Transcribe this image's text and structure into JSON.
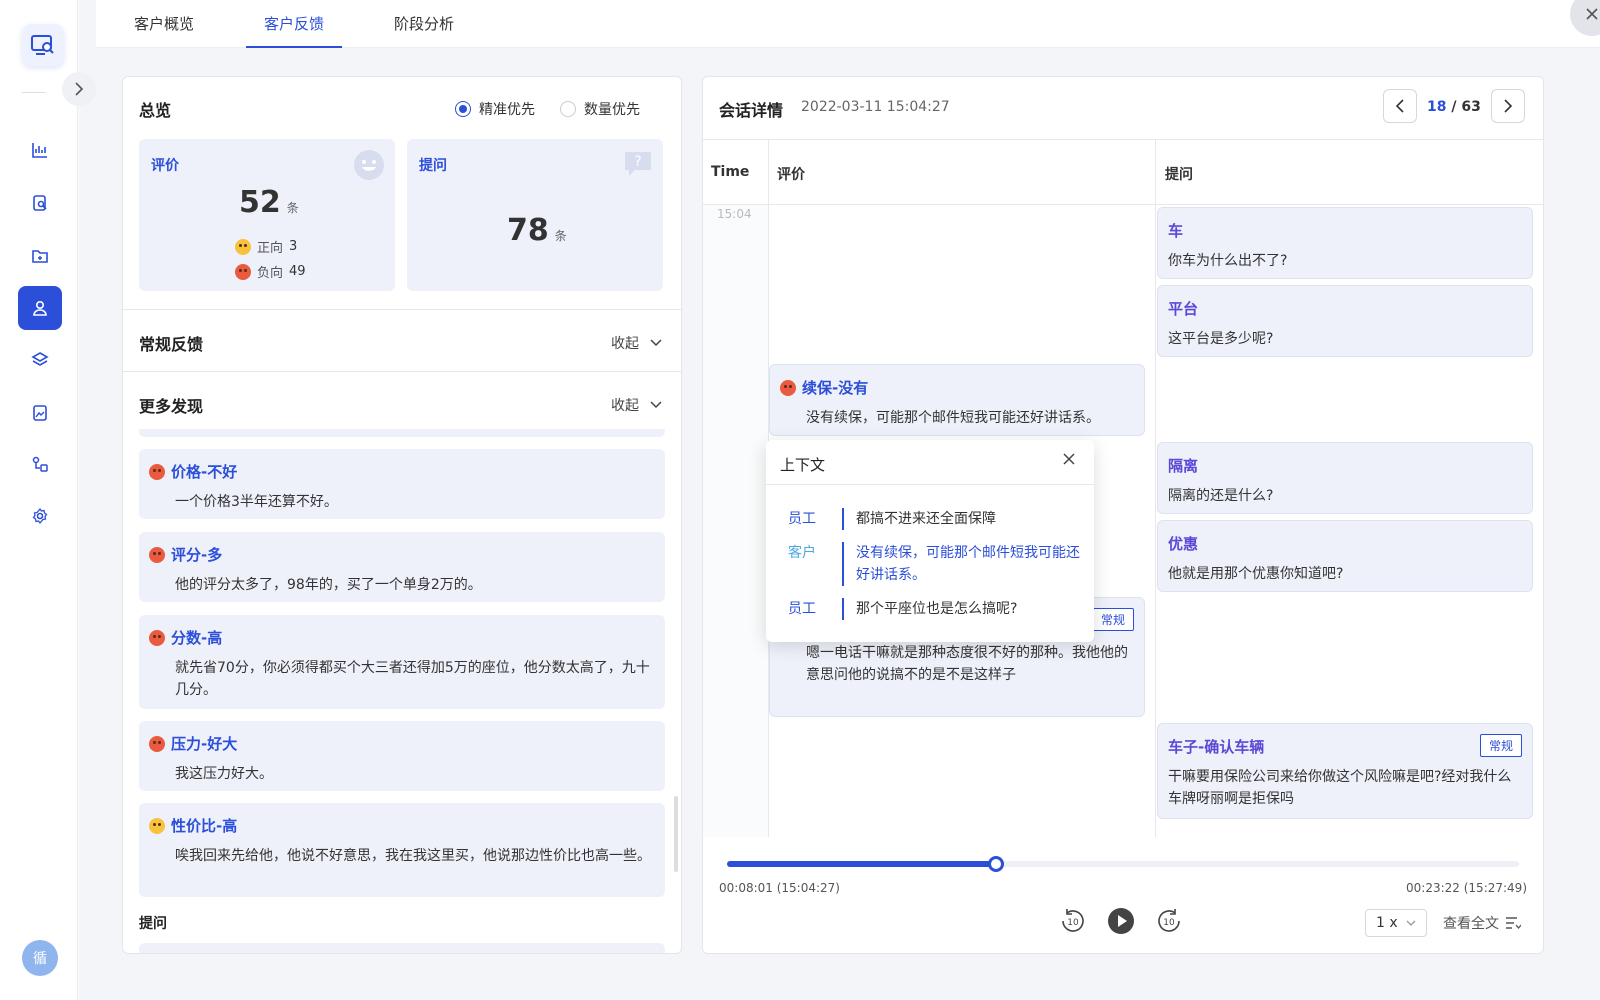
{
  "sidebar": {
    "avatar_text": "循",
    "icons": [
      "chart-icon",
      "search-document-icon",
      "folder-icon",
      "user-icon",
      "layers-icon",
      "image-icon",
      "share-icon",
      "settings-icon"
    ]
  },
  "tabs": [
    {
      "label": "客户概览"
    },
    {
      "label": "客户反馈",
      "active": true
    },
    {
      "label": "阶段分析"
    }
  ],
  "overview": {
    "title": "总览",
    "radio_precise": "精准优先",
    "radio_quantity": "数量优先",
    "review": {
      "label": "评价",
      "count": "52",
      "unit": "条",
      "positive_label": "正向",
      "positive_count": "3",
      "negative_label": "负向",
      "negative_count": "49"
    },
    "question": {
      "label": "提问",
      "count": "78",
      "unit": "条"
    }
  },
  "sections": {
    "regular": {
      "title": "常规反馈",
      "collapse": "收起"
    },
    "more": {
      "title": "更多发现",
      "collapse": "收起"
    },
    "question_footer": "提问"
  },
  "feedback_items": [
    {
      "title": "价格-不好",
      "body": "一个价格3半年还算不好。",
      "sentiment": "negative"
    },
    {
      "title": "评分-多",
      "body": "他的评分太多了，98年的，买了一个单身2万的。",
      "sentiment": "negative"
    },
    {
      "title": "分数-高",
      "body": "就先省70分，你必须得都买个大三者还得加5万的座位，他分数太高了，九十几分。",
      "sentiment": "negative"
    },
    {
      "title": "压力-好大",
      "body": "我这压力好大。",
      "sentiment": "negative"
    },
    {
      "title": "性价比-高",
      "body": "唉我回来先给他，他说不好意思，我在我这里买，他说那边性价比也高一些。",
      "sentiment": "positive"
    }
  ],
  "session": {
    "title": "会话详情",
    "datetime": "2022-03-11 15:04:27",
    "page_current": "18",
    "page_total": "/ 63",
    "col_time": "Time",
    "col_review": "评价",
    "col_question": "提问",
    "time_mark": "15:04"
  },
  "review_bubbles": [
    {
      "title": "续保-没有",
      "body": "没有续保，可能那个邮件短我可能还好讲话系。"
    },
    {
      "title": "",
      "tag": "常规",
      "body": "嗯一电话干嘛就是那种态度很不好的那种。我他他的意思问他的说搞不的是不是这样子"
    }
  ],
  "question_bubbles": [
    {
      "title": "车",
      "body": "你车为什么出不了?"
    },
    {
      "title": "平台",
      "body": "这平台是多少呢?"
    },
    {
      "title": "隔离",
      "body": "隔离的还是什么?"
    },
    {
      "title": "优惠",
      "body": "他就是用那个优惠你知道吧?"
    },
    {
      "title": "车子-确认车辆",
      "tag": "常规",
      "body": "干嘛要用保险公司来给你做这个风险嘛是吧?经对我什么车牌呀丽啊是拒保吗"
    }
  ],
  "context_popup": {
    "title": "上下文",
    "lines": [
      {
        "who": "员工",
        "text": "都搞不进来还全面保障"
      },
      {
        "who": "客户",
        "text": "没有续保，可能那个邮件短我可能还好讲话系。"
      },
      {
        "who": "员工",
        "text": "那个平座位也是怎么搞呢?"
      }
    ]
  },
  "player": {
    "progress_fraction": 0.34,
    "time_current": "00:08:01 (15:04:27)",
    "time_total": "00:23:22 (15:27:49)",
    "rewind_label": "10",
    "forward_label": "10",
    "speed": "1 x",
    "full_text": "查看全文"
  },
  "colors": {
    "accent": "#2b4fd8",
    "card_bg": "#eef1fa",
    "negative": "#ea5a3e",
    "positive": "#f6c33b"
  }
}
